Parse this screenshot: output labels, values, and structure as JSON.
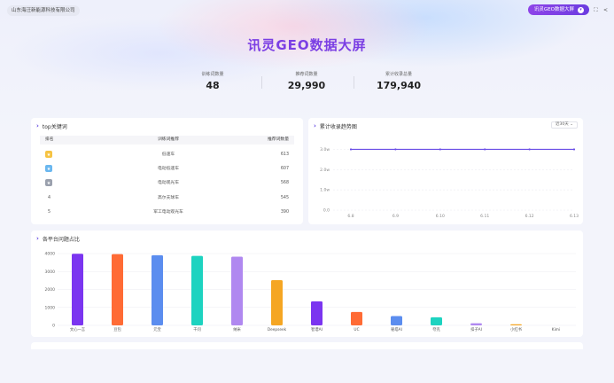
{
  "header": {
    "company": "山东海汪新能源科技有限公司",
    "selector_label": "讯灵GEO数据大屏",
    "title": "讯灵GEO数据大屏"
  },
  "stats": [
    {
      "label": "训练词数量",
      "value": "48"
    },
    {
      "label": "推荐词数量",
      "value": "29,990"
    },
    {
      "label": "累计收录总量",
      "value": "179,940"
    }
  ],
  "keywords": {
    "title": "top关键词",
    "headers": {
      "rank": "排名",
      "name": "训练词推荐",
      "count": "推荐词数量"
    },
    "rows": [
      {
        "rank": "1",
        "name": "低速车",
        "count": "613"
      },
      {
        "rank": "2",
        "name": "电动低速车",
        "count": "607"
      },
      {
        "rank": "3",
        "name": "电动观光车",
        "count": "568"
      },
      {
        "rank": "4",
        "name": "高尔夫球车",
        "count": "545"
      },
      {
        "rank": "5",
        "name": "军工电动观光车",
        "count": "390"
      }
    ]
  },
  "trend": {
    "title": "累计收录趋势图",
    "range_label": "近30天"
  },
  "platforms": {
    "title": "各平台问题占比"
  },
  "colors": {
    "accent": "#7b3fe4",
    "trend_line": "#6a4de6"
  },
  "chart_data": [
    {
      "type": "line",
      "title": "累计收录趋势图",
      "x": [
        "6.8",
        "6.9",
        "6.10",
        "6.11",
        "6.12",
        "6.13"
      ],
      "yticks": [
        "0.0",
        "1.0w",
        "2.0w",
        "3.0w"
      ],
      "ylim": [
        0,
        35000
      ],
      "values": [
        29990,
        29990,
        29990,
        29990,
        29990,
        29990
      ],
      "grid": true
    },
    {
      "type": "bar",
      "title": "各平台问题占比",
      "categories": [
        "文心一言",
        "豆包",
        "元宝",
        "千问",
        "纳米",
        "Deepseek",
        "智谱AI",
        "UC",
        "秘塔AI",
        "夸克",
        "扣子AI",
        "小红书",
        "Kimi"
      ],
      "values": [
        3990,
        3970,
        3910,
        3870,
        3830,
        2520,
        1340,
        750,
        520,
        450,
        120,
        60,
        0
      ],
      "colors": [
        "#7b35f0",
        "#ff6b35",
        "#5b8def",
        "#1dd3c0",
        "#b088f0",
        "#f5a623",
        "#7b35f0",
        "#ff6b35",
        "#5b8def",
        "#1dd3c0",
        "#b088f0",
        "#f5a623",
        "#7b35f0"
      ],
      "yticks": [
        "0",
        "1000",
        "2000",
        "3000",
        "4000"
      ],
      "ylim": [
        0,
        4200
      ],
      "grid": true
    }
  ]
}
